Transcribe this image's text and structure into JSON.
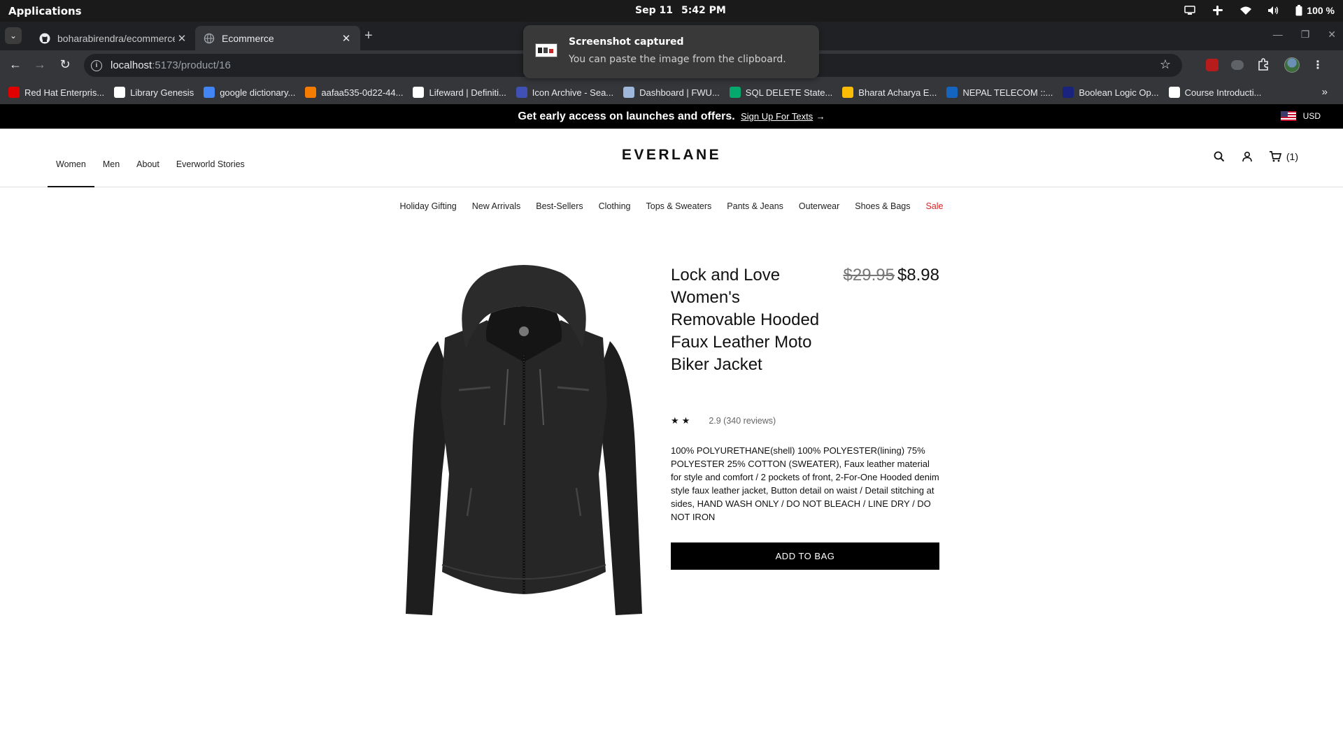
{
  "os": {
    "apps_label": "Applications",
    "date": "Sep 11",
    "time": "5:42 PM",
    "battery": "100 %"
  },
  "browser": {
    "tabs": [
      {
        "title": "boharabirendra/ecommerce",
        "icon": "github-icon"
      },
      {
        "title": "Ecommerce",
        "icon": "globe-icon"
      }
    ],
    "address": {
      "host": "localhost",
      "path": ":5173/product/16"
    },
    "bookmarks": [
      {
        "label": "Red Hat Enterpris...",
        "color": "#e00000"
      },
      {
        "label": "Library Genesis",
        "color": "#ffffff"
      },
      {
        "label": "google dictionary...",
        "color": "#4285f4"
      },
      {
        "label": "aafaa535-0d22-44...",
        "color": "#f57c00"
      },
      {
        "label": "Lifeward | Definiti...",
        "color": "#ffffff"
      },
      {
        "label": "Icon Archive - Sea...",
        "color": "#3f51b5"
      },
      {
        "label": "Dashboard | FWU...",
        "color": "#9fb8d9"
      },
      {
        "label": "SQL DELETE State...",
        "color": "#04aa6d"
      },
      {
        "label": "Bharat Acharya E...",
        "color": "#fbbc05"
      },
      {
        "label": "NEPAL TELECOM ::...",
        "color": "#1565c0"
      },
      {
        "label": "Boolean Logic Op...",
        "color": "#1a237e"
      },
      {
        "label": "Course Introducti...",
        "color": "#ffffff"
      }
    ]
  },
  "toast": {
    "title": "Screenshot captured",
    "body": "You can paste the image from the clipboard."
  },
  "promo": {
    "text": "Get early access on launches and offers.",
    "link": "Sign Up For Texts",
    "arrow": "→",
    "currency": "USD"
  },
  "header": {
    "nav": [
      "Women",
      "Men",
      "About",
      "Everworld Stories"
    ],
    "logo": "EVERLANE",
    "cart_count": "(1)"
  },
  "categories": [
    "Holiday Gifting",
    "New Arrivals",
    "Best-Sellers",
    "Clothing",
    "Tops & Sweaters",
    "Pants & Jeans",
    "Outerwear",
    "Shoes & Bags",
    "Sale"
  ],
  "product": {
    "title": "Lock and Love Women's Removable Hooded Faux Leather Moto Biker Jacket",
    "price_old": "$29.95",
    "price_new": "$8.98",
    "stars": "★★",
    "rating_text": "2.9 (340 reviews)",
    "description": "100% POLYURETHANE(shell) 100% POLYESTER(lining) 75% POLYESTER 25% COTTON (SWEATER), Faux leather material for style and comfort / 2 pockets of front, 2-For-One Hooded denim style faux leather jacket, Button detail on waist / Detail stitching at sides, HAND WASH ONLY / DO NOT BLEACH / LINE DRY / DO NOT IRON",
    "add_to_bag": "ADD TO BAG"
  },
  "colors": {
    "sale": "#e02020",
    "promo_bg": "#000000"
  }
}
